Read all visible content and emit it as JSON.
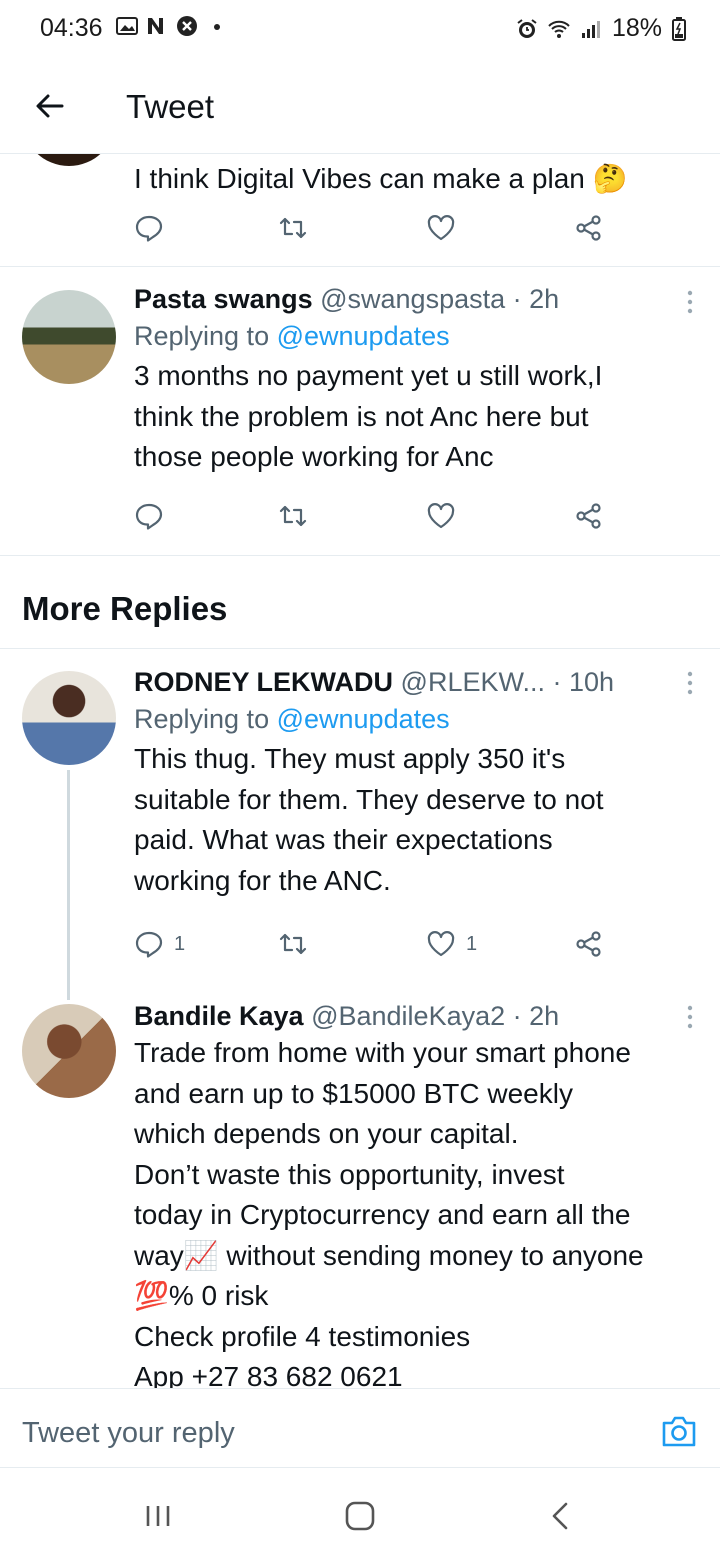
{
  "status_bar": {
    "time": "04:36",
    "battery": "18%"
  },
  "app_bar": {
    "title": "Tweet"
  },
  "tweets": [
    {
      "text_lines": [
        "I think Digital Vibes can make a plan 🤔"
      ]
    },
    {
      "name": "Pasta swangs",
      "handle": "@swangspasta",
      "time": "· 2h",
      "replying_prefix": "Replying to ",
      "replying_handle": "@ewnupdates",
      "text_lines": [
        "3 months no payment yet u still work,I",
        "think the problem is not Anc here but",
        "those people working for Anc"
      ]
    },
    {
      "name": "RODNEY  LEKWADU",
      "handle": "@RLEKW...",
      "time": "· 10h",
      "replying_prefix": "Replying to ",
      "replying_handle": "@ewnupdates",
      "text_lines": [
        "This thug. They must apply 350 it's",
        "suitable for them. They deserve to not",
        "paid. What was their expectations",
        "working for the ANC."
      ],
      "reply_count": "1",
      "like_count": "1"
    },
    {
      "name": "Bandile Kaya",
      "handle": "@BandileKaya2",
      "time": "· 2h",
      "text_lines": [
        "Trade from home with your smart phone",
        "and earn up to $15000 BTC weekly",
        "which depends on your capital.",
        "Don’t waste this opportunity, invest",
        "today in Cryptocurrency and earn all the",
        "way📈 without sending money to anyone",
        "💯% 0 risk",
        "Check profile 4 testimonies",
        "App +27 83 682 0621"
      ]
    }
  ],
  "section": {
    "more_replies": "More Replies"
  },
  "reply_bar": {
    "placeholder": "Tweet your reply"
  },
  "colors": {
    "accent": "#1d9bf0",
    "secondary_text": "#536471",
    "divider": "#e6ecf0"
  }
}
